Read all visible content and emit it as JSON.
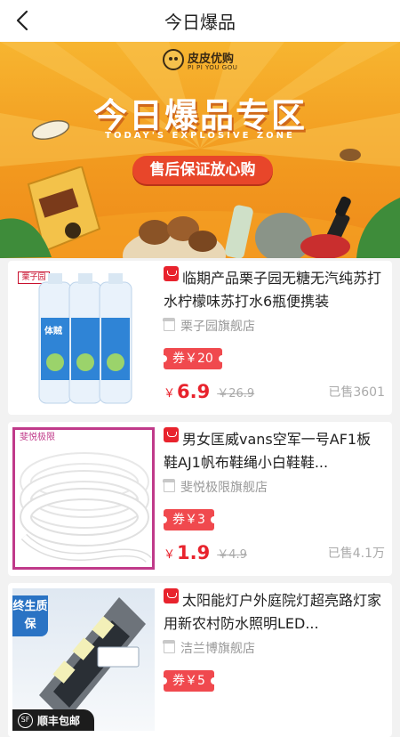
{
  "header": {
    "title": "今日爆品"
  },
  "banner": {
    "logo_cn": "皮皮优购",
    "logo_en": "PI PI YOU GOU",
    "title": "今日爆品专区",
    "subtitle": "TODAY'S EXPLOSIVE ZONE",
    "pill": "售后保证放心购"
  },
  "products": [
    {
      "title": "临期产品栗子园无糖无汽纯苏打水柠檬味苏打水6瓶便携装",
      "shop": "栗子园旗舰店",
      "coupon": "券￥20",
      "currency": "￥",
      "price": "6.9",
      "original": "￥26.9",
      "sold": "已售3601",
      "image_label": "栗子园",
      "bottle_label": "体贼"
    },
    {
      "title": "男女匡威vans空军一号AF1板鞋AJ1帆布鞋绳小白鞋鞋...",
      "shop": "斐悦极限旗舰店",
      "coupon": "券￥3",
      "currency": "￥",
      "price": "1.9",
      "original": "￥4.9",
      "sold": "已售4.1万",
      "image_label": "斐悦极限"
    },
    {
      "title": "太阳能灯户外庭院灯超亮路灯家用新农村防水照明LED...",
      "shop": "洁兰博旗舰店",
      "coupon": "券￥5",
      "image_badge": "终生质保",
      "image_bottom": "顺丰包邮",
      "image_sf": "SF"
    }
  ]
}
